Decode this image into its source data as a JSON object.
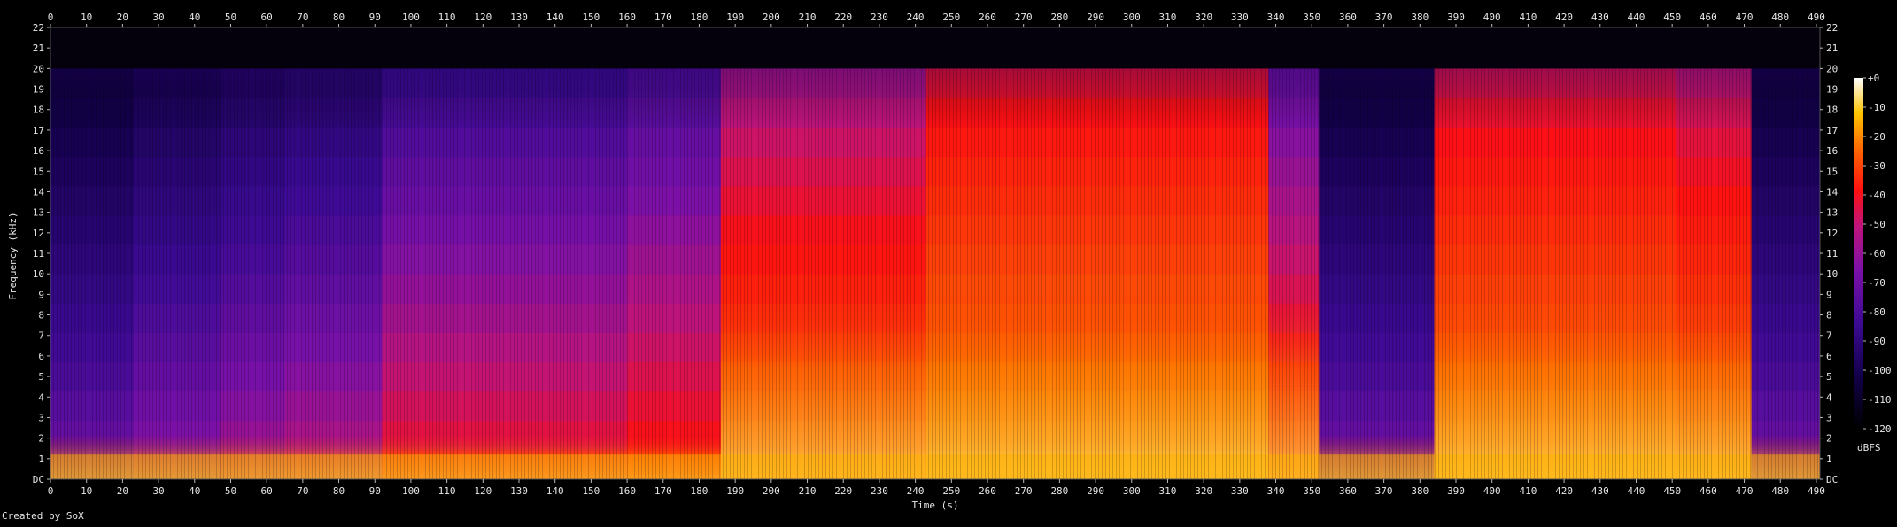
{
  "footer": "Created by SoX",
  "chart_data": {
    "type": "heatmap",
    "title": "",
    "xlabel": "Time (s)",
    "ylabel": "Frequency (kHz)",
    "xlim": [
      0,
      491
    ],
    "ylim": [
      0,
      22
    ],
    "x_ticks": [
      0,
      10,
      20,
      30,
      40,
      50,
      60,
      70,
      80,
      90,
      100,
      110,
      120,
      130,
      140,
      150,
      160,
      170,
      180,
      190,
      200,
      210,
      220,
      230,
      240,
      250,
      260,
      270,
      280,
      290,
      300,
      310,
      320,
      330,
      340,
      350,
      360,
      370,
      380,
      390,
      400,
      410,
      420,
      430,
      440,
      450,
      460,
      470,
      480,
      490
    ],
    "y_ticks": [
      {
        "value": 0,
        "label": "DC"
      },
      {
        "value": 1,
        "label": "1"
      },
      {
        "value": 2,
        "label": "2"
      },
      {
        "value": 3,
        "label": "3"
      },
      {
        "value": 4,
        "label": "4"
      },
      {
        "value": 5,
        "label": "5"
      },
      {
        "value": 6,
        "label": "6"
      },
      {
        "value": 7,
        "label": "7"
      },
      {
        "value": 8,
        "label": "8"
      },
      {
        "value": 9,
        "label": "9"
      },
      {
        "value": 10,
        "label": "10"
      },
      {
        "value": 11,
        "label": "11"
      },
      {
        "value": 12,
        "label": "12"
      },
      {
        "value": 13,
        "label": "13"
      },
      {
        "value": 14,
        "label": "14"
      },
      {
        "value": 15,
        "label": "15"
      },
      {
        "value": 16,
        "label": "16"
      },
      {
        "value": 17,
        "label": "17"
      },
      {
        "value": 18,
        "label": "18"
      },
      {
        "value": 19,
        "label": "19"
      },
      {
        "value": 20,
        "label": "20"
      },
      {
        "value": 21,
        "label": "21"
      },
      {
        "value": 22,
        "label": "22"
      }
    ],
    "colorbar": {
      "label": "dBFS",
      "range": [
        -120,
        0
      ],
      "ticks": [
        {
          "value": 0,
          "label": "+0"
        },
        {
          "value": -10,
          "label": "-10"
        },
        {
          "value": -20,
          "label": "-20"
        },
        {
          "value": -30,
          "label": "-30"
        },
        {
          "value": -40,
          "label": "-40"
        },
        {
          "value": -50,
          "label": "-50"
        },
        {
          "value": -60,
          "label": "-60"
        },
        {
          "value": -70,
          "label": "-70"
        },
        {
          "value": -80,
          "label": "-80"
        },
        {
          "value": -90,
          "label": "-90"
        },
        {
          "value": -100,
          "label": "-100"
        },
        {
          "value": -110,
          "label": "-110"
        },
        {
          "value": -120,
          "label": "-120"
        }
      ]
    },
    "bandwidth_cutoff_khz": 20,
    "segments": [
      {
        "start": 0,
        "end": 23,
        "level_db": -92
      },
      {
        "start": 23,
        "end": 47,
        "level_db": -88
      },
      {
        "start": 47,
        "end": 65,
        "level_db": -85
      },
      {
        "start": 65,
        "end": 92,
        "level_db": -83
      },
      {
        "start": 92,
        "end": 160,
        "level_db": -76
      },
      {
        "start": 160,
        "end": 186,
        "level_db": -73
      },
      {
        "start": 186,
        "end": 243,
        "level_db": -60
      },
      {
        "start": 243,
        "end": 338,
        "level_db": -52
      },
      {
        "start": 338,
        "end": 352,
        "level_db": -68
      },
      {
        "start": 352,
        "end": 384,
        "level_db": -92
      },
      {
        "start": 384,
        "end": 451,
        "level_db": -54
      },
      {
        "start": 451,
        "end": 472,
        "level_db": -57
      },
      {
        "start": 472,
        "end": 491,
        "level_db": -92
      }
    ]
  }
}
